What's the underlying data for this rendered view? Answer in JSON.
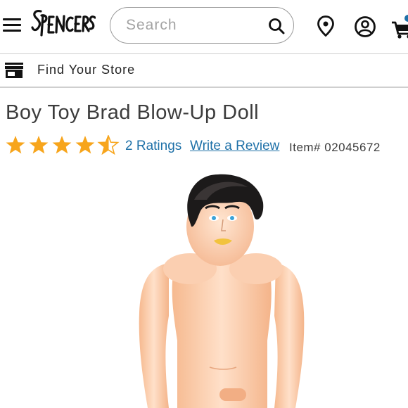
{
  "header": {
    "search": {
      "placeholder": "Search",
      "value": ""
    },
    "icons": [
      "menu-icon",
      "store-logo",
      "search-icon",
      "location-pin-icon",
      "account-icon",
      "cart-icon"
    ],
    "logo_text": "SPENCERS"
  },
  "store_bar": {
    "label": "Find Your Store",
    "icon": "store-icon"
  },
  "product": {
    "title": "Boy Toy Brad Blow-Up Doll",
    "rating": 4.5,
    "rating_max": 5,
    "ratings_count_label": "2 Ratings",
    "write_review_label": "Write a Review",
    "item_label": "Item# 02045672"
  },
  "colors": {
    "star": "#f7a51c",
    "link": "#1f71a8",
    "text": "#3c3c3c",
    "border": "#cfcfcf"
  }
}
